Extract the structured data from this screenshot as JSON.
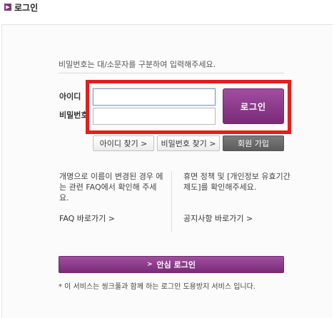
{
  "header": {
    "icon": "arrow-right-icon",
    "icon_glyph": "▶",
    "title": "로그인"
  },
  "login": {
    "hint": "비밀번호는 대/소문자를 구분하여 입력해주세요.",
    "id_label": "아이디",
    "pw_label": "비밀번호",
    "id_value": "",
    "pw_value": "",
    "login_button": "로그인",
    "highlight_color": "#e51d1d",
    "accent_color": "#7a2b78"
  },
  "actions": {
    "find_id": "아이디 찾기 >",
    "find_pw": "비밀번호 찾기 >",
    "join": "회원 가입"
  },
  "info": {
    "left_text": "개명으로 이름이 변경된 경우 에는 관련 FAQ에서 확인해 주세요.",
    "left_link": "FAQ 바로가기 >",
    "right_text": "휴면 정책 및 [개인정보 유효기간 제도]를 확인해주세요.",
    "right_link": "공지사항 바로가기 >"
  },
  "safe_login": {
    "arrow": ">",
    "label": "안심 로그인"
  },
  "note": "* 이 서비스는 씽크풀과 함께 하는 로그인 도용방지 서비스 입니다."
}
